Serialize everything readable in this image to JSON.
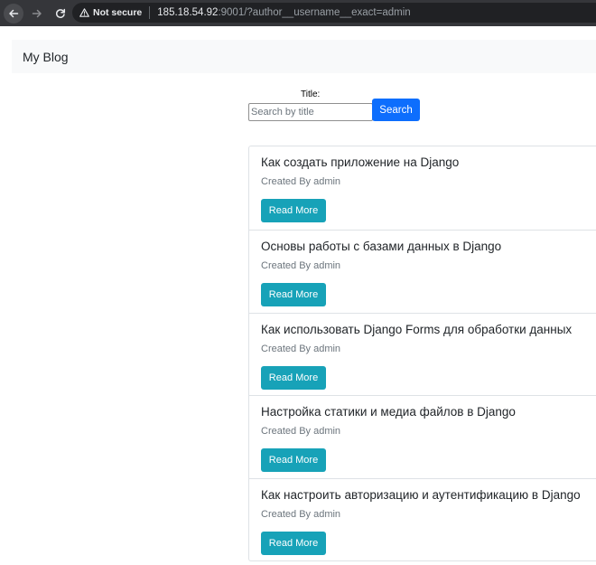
{
  "browser": {
    "security_label": "Not secure",
    "url_host": "185.18.54.92",
    "url_rest": ":9001/?author__username__exact=admin"
  },
  "navbar": {
    "brand": "My Blog"
  },
  "search": {
    "label": "Title:",
    "placeholder": "Search by title",
    "value": "",
    "button_label": "Search"
  },
  "posts": [
    {
      "title": "Как создать приложение на Django",
      "meta": "Created By admin",
      "button_label": "Read More"
    },
    {
      "title": "Основы работы с базами данных в Django",
      "meta": "Created By admin",
      "button_label": "Read More"
    },
    {
      "title": "Как использовать Django Forms для обработки данных",
      "meta": "Created By admin",
      "button_label": "Read More"
    },
    {
      "title": "Настройка статики и медиа файлов в Django",
      "meta": "Created By admin",
      "button_label": "Read More"
    },
    {
      "title": "Как настроить авторизацию и аутентификацию в Django",
      "meta": "Created By admin",
      "button_label": "Read More"
    }
  ],
  "colors": {
    "primary": "#0d6efd",
    "info": "#17a2b8",
    "navbar_bg": "#f8f9fa",
    "browser_bg": "#35363a"
  }
}
